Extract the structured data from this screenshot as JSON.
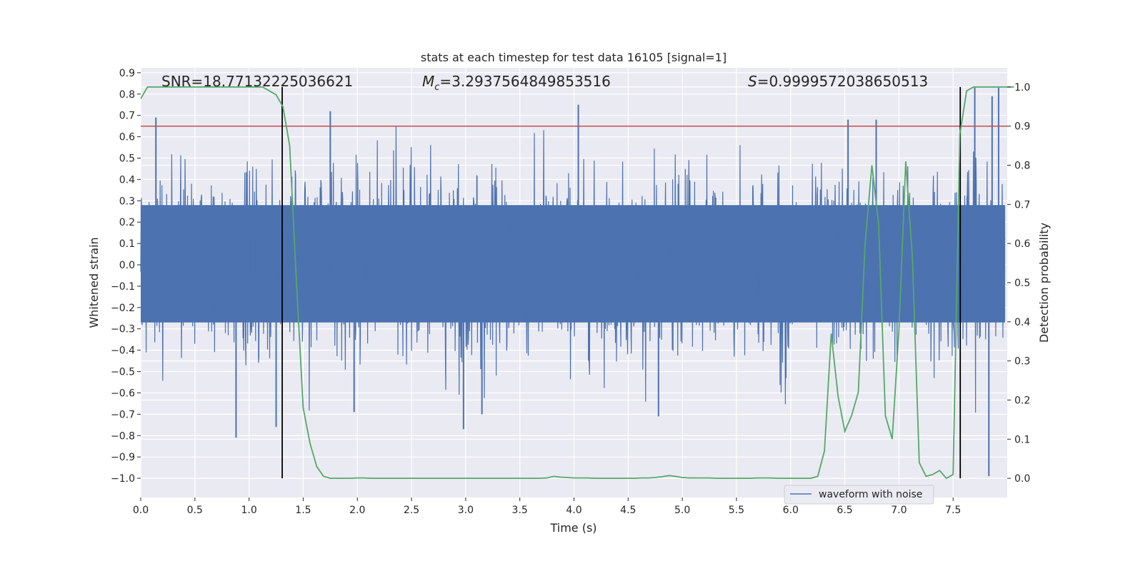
{
  "chart_data": {
    "type": "line",
    "title": "stats at each timestep for test data 16105 [signal=1]",
    "xlabel": "Time (s)",
    "ylabel_left": "Whitened strain",
    "ylabel_right": "Detection probability",
    "xlim": [
      0,
      8.0
    ],
    "ylim_left": [
      -1.09,
      0.923
    ],
    "ylim_right": [
      -0.049,
      1.049
    ],
    "grid": true,
    "x_ticks": [
      "0.0",
      "0.5",
      "1.0",
      "1.5",
      "2.0",
      "2.5",
      "3.0",
      "3.5",
      "4.0",
      "4.5",
      "5.0",
      "5.5",
      "6.0",
      "6.5",
      "7.0",
      "7.5"
    ],
    "y_ticks_left": [
      "0.9",
      "0.8",
      "0.7",
      "0.6",
      "0.5",
      "0.4",
      "0.3",
      "0.2",
      "0.1",
      "0.0",
      "−0.1",
      "−0.2",
      "−0.3",
      "−0.4",
      "−0.5",
      "−0.6",
      "−0.7",
      "−0.8",
      "−0.9",
      "−1.0"
    ],
    "y_ticks_right": [
      "1.0",
      "0.9",
      "0.8",
      "0.7",
      "0.6",
      "0.5",
      "0.4",
      "0.3",
      "0.2",
      "0.1",
      "0.0"
    ],
    "annotations": {
      "snr": "SNR=18.77132225036621",
      "mc_symbol": "M",
      "mc_sub": "c",
      "mc_value": "=3.2937564849853516",
      "s_symbol": "S",
      "s_value": "=0.9999572038650513"
    },
    "legend": {
      "placement": "lower-right",
      "entries": [
        "waveform with noise"
      ]
    },
    "colors": {
      "waveform": "#4c72b0",
      "probability": "#55a868",
      "threshold": "#c44e52",
      "markers": "#000000",
      "background": "#eaeaf2"
    },
    "waveform": {
      "name": "waveform with noise",
      "axis": "left",
      "typical_amplitude": 0.45,
      "notable_peaks": [
        [
          0.14,
          0.69
        ],
        [
          0.88,
          -0.81
        ],
        [
          1.25,
          -0.76
        ],
        [
          1.75,
          0.72
        ],
        [
          1.97,
          -0.69
        ],
        [
          2.98,
          -0.77
        ],
        [
          3.15,
          -0.7
        ],
        [
          4.04,
          0.75
        ],
        [
          4.78,
          -0.71
        ],
        [
          6.53,
          0.68
        ],
        [
          6.79,
          0.68
        ],
        [
          7.7,
          0.83
        ],
        [
          7.83,
          -0.99
        ],
        [
          7.92,
          0.83
        ],
        [
          7.86,
          0.79
        ]
      ]
    },
    "probability": {
      "axis": "right",
      "t_step": 0.0625,
      "values": [
        0.97,
        1.0,
        1.0,
        1.0,
        1.0,
        1.0,
        1.0,
        1.0,
        1.0,
        1.0,
        1.0,
        1.0,
        1.0,
        1.0,
        1.0,
        1.0,
        1.0,
        1.0,
        1.0,
        0.99,
        0.98,
        0.95,
        0.85,
        0.5,
        0.18,
        0.09,
        0.03,
        0.005,
        0.0,
        0.0,
        0.0,
        0.0,
        0.001,
        0.001,
        0.0,
        0.0,
        0.0,
        0.0,
        0.0,
        0.0,
        0.0,
        0.0,
        0.0,
        0.0,
        0.0,
        0.0,
        0.0,
        0.0,
        0.0,
        0.0,
        0.0,
        0.0,
        0.0,
        0.0,
        0.0,
        0.0,
        0.0,
        0.0,
        0.0,
        0.0,
        0.001,
        0.005,
        0.003,
        0.002,
        0.001,
        0.001,
        0.001,
        0.0,
        0.0,
        0.0,
        0.0,
        0.0,
        0.0,
        0.0,
        0.001,
        0.001,
        0.002,
        0.004,
        0.007,
        0.005,
        0.002,
        0.001,
        0.001,
        0.001,
        0.001,
        0.0,
        0.0,
        0.0,
        0.0,
        0.0,
        0.0,
        0.001,
        0.001,
        0.001,
        0.0,
        0.0,
        0.0,
        0.0,
        0.0,
        0.0,
        0.005,
        0.07,
        0.37,
        0.21,
        0.12,
        0.16,
        0.22,
        0.6,
        0.8,
        0.65,
        0.16,
        0.1,
        0.38,
        0.81,
        0.56,
        0.04,
        0.005,
        0.01,
        0.02,
        0.0,
        0.01,
        0.88,
        0.99,
        1.0,
        1.0,
        1.0,
        1.0,
        1.0,
        1.0,
        1.0
      ]
    },
    "threshold_right": 0.9,
    "vertical_markers_s": [
      1.306,
      7.566
    ]
  }
}
